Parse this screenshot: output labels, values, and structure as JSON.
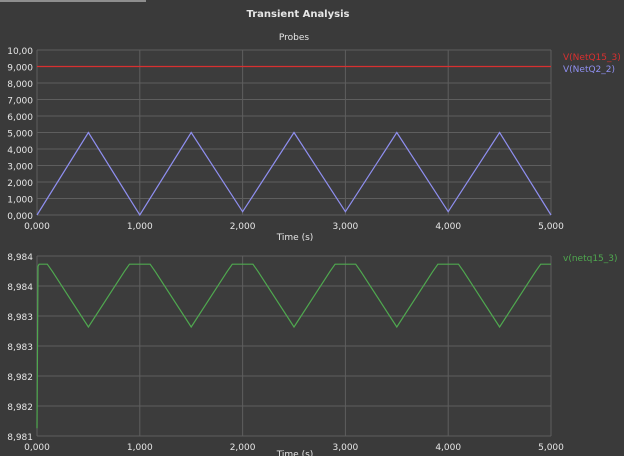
{
  "window": {
    "title": "Transient Analysis",
    "subtitle": "Probes"
  },
  "colors": {
    "background": "#3a3a3a",
    "plot_background": "#3c3c3c",
    "grid": "#5e5e5e",
    "text": "#e6e6e6",
    "red_trace": "#d83030",
    "blue_trace": "#8f8ff0",
    "green_trace": "#4fa84f"
  },
  "chart_data": [
    {
      "type": "line",
      "title": "Transient Analysis",
      "subtitle": "Probes",
      "xlabel": "Time (s)",
      "ylabel": "",
      "xlim": [
        0,
        5
      ],
      "ylim": [
        0,
        10
      ],
      "x_ticks": [
        "0,000",
        "1,000",
        "2,000",
        "3,000",
        "4,000",
        "5,000"
      ],
      "y_ticks": [
        "0,000",
        "1,000",
        "2,000",
        "3,000",
        "4,000",
        "5,000",
        "6,000",
        "7,000",
        "8,000",
        "9,000",
        "10,00"
      ],
      "grid": true,
      "legend_position": "top-right",
      "series": [
        {
          "name": "V(NetQ15_3)",
          "color": "#d83030",
          "x": [
            0,
            5
          ],
          "y": [
            9.0,
            9.0
          ]
        },
        {
          "name": "V(NetQ2_2)",
          "color": "#8f8ff0",
          "x": [
            0,
            0.5,
            1.0,
            1.5,
            2.0,
            2.5,
            3.0,
            3.5,
            4.0,
            4.5,
            5.0
          ],
          "y": [
            0,
            5,
            0,
            5,
            0.2,
            5,
            0.2,
            5,
            0.2,
            5,
            0
          ]
        }
      ]
    },
    {
      "type": "line",
      "xlabel": "Time (s)",
      "ylabel": "",
      "xlim": [
        0,
        5
      ],
      "ylim": [
        8.981,
        8.9845
      ],
      "x_ticks": [
        "0,000",
        "1,000",
        "2,000",
        "3,000",
        "4,000",
        "5,000"
      ],
      "y_ticks": [
        "8,981",
        "8,982",
        "8,982",
        "8,983",
        "8,983",
        "8,984",
        "8,984"
      ],
      "grid": true,
      "legend_position": "top-right",
      "series": [
        {
          "name": "v(netq15_3)",
          "color": "#4fa84f",
          "x": [
            0,
            0.01,
            0.02,
            0.1,
            0.15,
            0.5,
            0.85,
            0.9,
            1.1,
            1.15,
            1.5,
            1.85,
            1.9,
            2.1,
            2.15,
            2.5,
            2.85,
            2.9,
            3.1,
            3.15,
            3.5,
            3.85,
            3.9,
            4.1,
            4.15,
            4.5,
            4.85,
            4.9,
            5.0
          ],
          "y": [
            8.98115,
            8.9843,
            8.98434,
            8.98434,
            8.9842,
            8.98312,
            8.9842,
            8.98434,
            8.98434,
            8.9842,
            8.98312,
            8.9842,
            8.98434,
            8.98434,
            8.9842,
            8.98312,
            8.9842,
            8.98434,
            8.98434,
            8.9842,
            8.98312,
            8.9842,
            8.98434,
            8.98434,
            8.9842,
            8.98312,
            8.9842,
            8.98434,
            8.98434
          ]
        }
      ]
    }
  ]
}
